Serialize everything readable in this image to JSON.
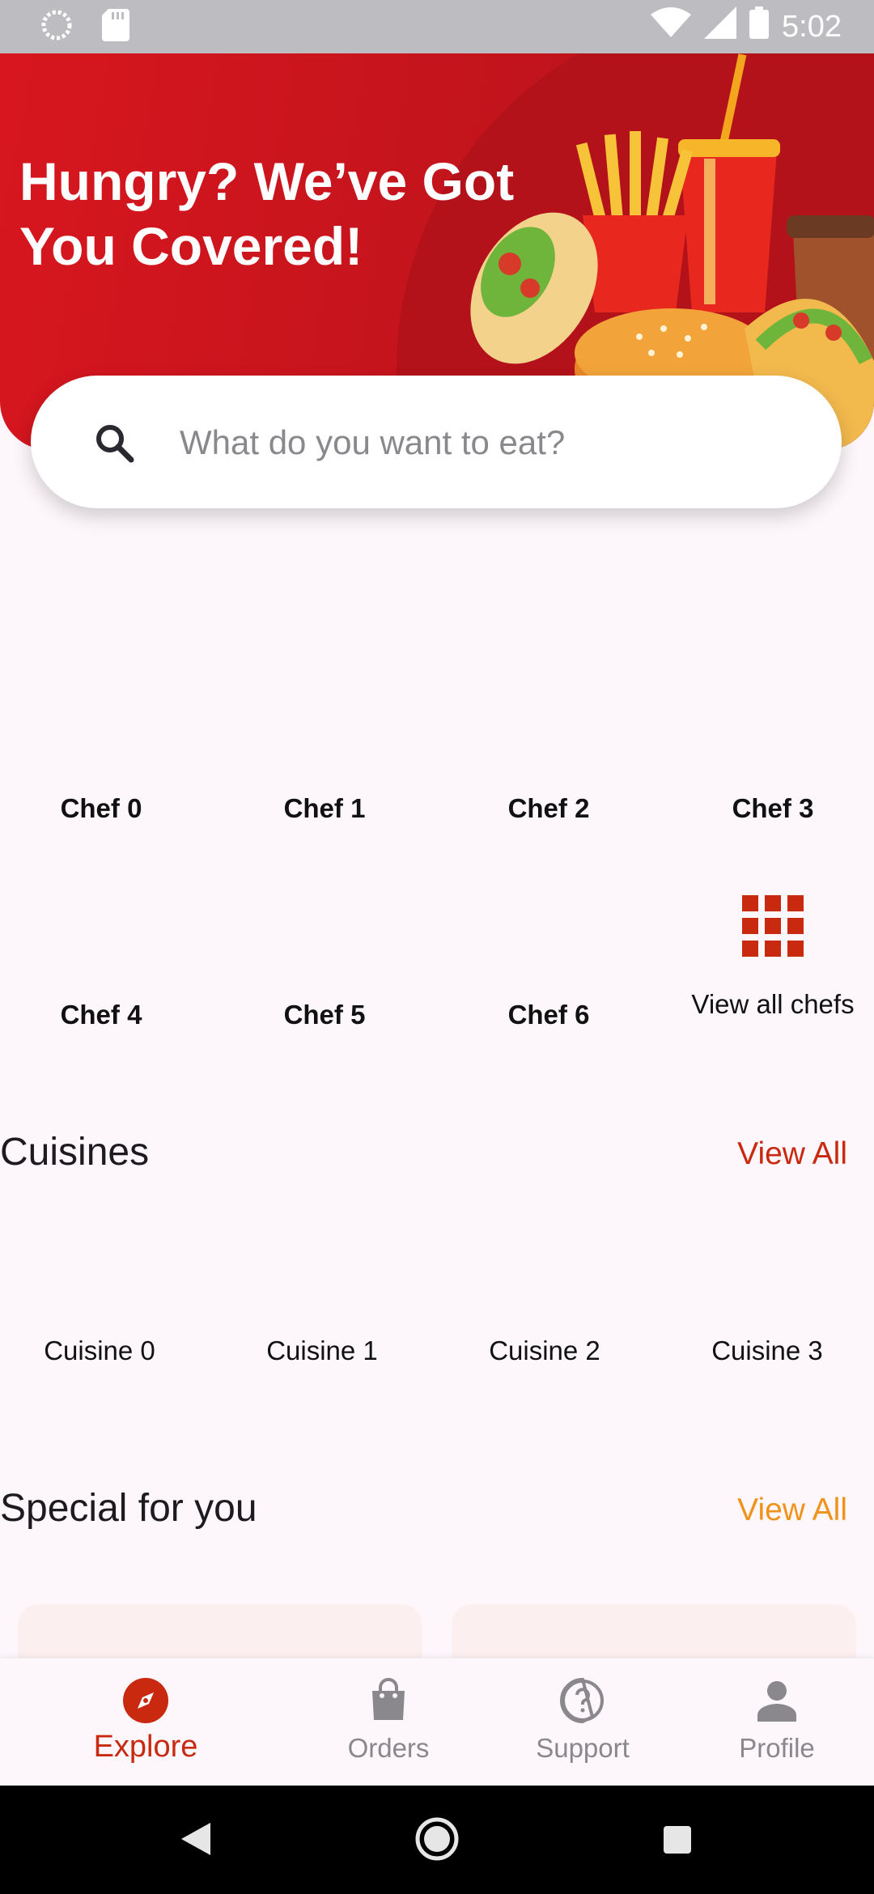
{
  "status_bar": {
    "time": "5:02"
  },
  "hero": {
    "title": "Hungry? We’ve Got You Covered!"
  },
  "search": {
    "placeholder": "What do you want to eat?"
  },
  "chefs": {
    "items": [
      "Chef 0",
      "Chef 1",
      "Chef 2",
      "Chef 3",
      "Chef 4",
      "Chef 5",
      "Chef 6"
    ],
    "view_all_label": "View all chefs"
  },
  "cuisines": {
    "title": "Cuisines",
    "view_all": "View All",
    "items": [
      "Cuisine 0",
      "Cuisine 1",
      "Cuisine 2",
      "Cuisine 3"
    ]
  },
  "special": {
    "title": "Special for you",
    "view_all": "View All"
  },
  "bottom_nav": {
    "items": [
      {
        "label": "Explore",
        "icon": "compass-icon",
        "active": true
      },
      {
        "label": "Orders",
        "icon": "shopping-bag-icon",
        "active": false
      },
      {
        "label": "Support",
        "icon": "help-icon",
        "active": false
      },
      {
        "label": "Profile",
        "icon": "person-icon",
        "active": false
      }
    ]
  },
  "colors": {
    "brand_red": "#c8290f",
    "accent_orange": "#f0931c",
    "hero_red": "#d8161f",
    "background": "#fdf7fc"
  }
}
